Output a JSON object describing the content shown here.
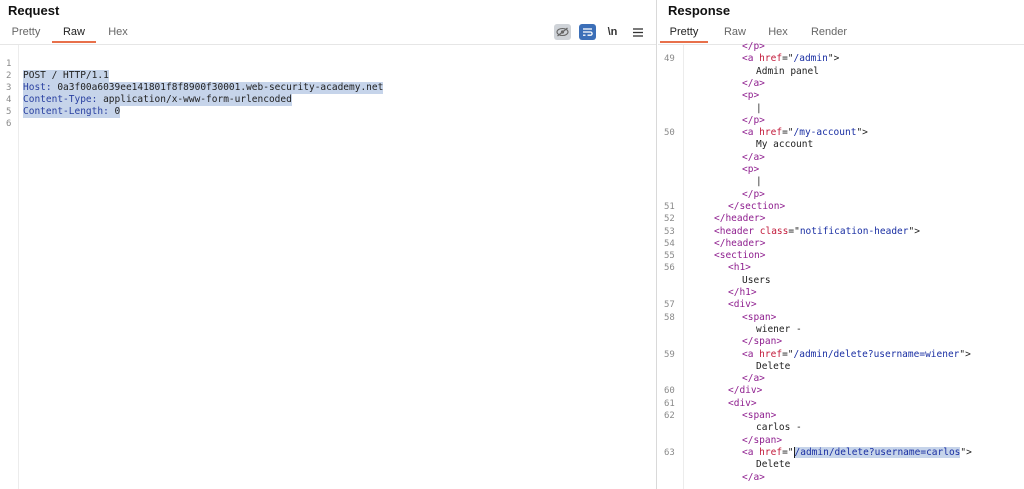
{
  "request": {
    "title": "Request",
    "tabs": [
      {
        "label": "Pretty",
        "active": false
      },
      {
        "label": "Raw",
        "active": true
      },
      {
        "label": "Hex",
        "active": false
      }
    ],
    "tools": {
      "hide_icon": "eye-off-icon",
      "wrap_icon": "wrap-lines-icon",
      "newline_label": "\\n",
      "menu_icon": "hamburger-menu-icon"
    },
    "lines": [
      {
        "num": "1",
        "method": "POST / HTTP/1.1"
      },
      {
        "num": "2",
        "name": "Host:",
        "value": " 0a3f00a6039ee141801f8f8900f30001.web-security-academy.net"
      },
      {
        "num": "3",
        "name": "Content-Type:",
        "value": " application/x-www-form-urlencoded"
      },
      {
        "num": "4",
        "name": "Content-Length:",
        "value": " 0"
      },
      {
        "num": "5"
      },
      {
        "num": "6"
      }
    ]
  },
  "response": {
    "title": "Response",
    "tabs": [
      {
        "label": "Pretty",
        "active": true
      },
      {
        "label": "Raw",
        "active": false
      },
      {
        "label": "Hex",
        "active": false
      },
      {
        "label": "Render",
        "active": false
      }
    ],
    "lines": {
      "l0": {
        "num": "",
        "tag": "</p>"
      },
      "l1": {
        "num": "49",
        "open": "<a ",
        "attr": "href",
        "eq": "=\"",
        "val": "/admin",
        "close": "\">"
      },
      "l2": {
        "num": "",
        "text": "Admin panel"
      },
      "l3": {
        "num": "",
        "tag": "</a>"
      },
      "l4": {
        "num": "",
        "tag": "<p>"
      },
      "l5": {
        "num": "",
        "text": "|"
      },
      "l6": {
        "num": "",
        "tag": "</p>"
      },
      "l7": {
        "num": "50",
        "open": "<a ",
        "attr": "href",
        "eq": "=\"",
        "val": "/my-account",
        "close": "\">"
      },
      "l8": {
        "num": "",
        "text": "My account"
      },
      "l9": {
        "num": "",
        "tag": "</a>"
      },
      "l10": {
        "num": "",
        "tag": "<p>"
      },
      "l11": {
        "num": "",
        "text": "|"
      },
      "l12": {
        "num": "",
        "tag": "</p>"
      },
      "l13": {
        "num": "51",
        "tag": "</section>"
      },
      "l14": {
        "num": "52",
        "tag": "</header>"
      },
      "l15": {
        "num": "53",
        "open": "<header ",
        "attr": "class",
        "eq": "=\"",
        "val": "notification-header",
        "close": "\">"
      },
      "l16": {
        "num": "54",
        "tag": "</header>"
      },
      "l17": {
        "num": "55",
        "tag": "<section>"
      },
      "l18": {
        "num": "56",
        "tag": "<h1>"
      },
      "l19": {
        "num": "",
        "text": "Users"
      },
      "l20": {
        "num": "",
        "tag": "</h1>"
      },
      "l21": {
        "num": "57",
        "tag": "<div>"
      },
      "l22": {
        "num": "58",
        "tag": "<span>"
      },
      "l23": {
        "num": "",
        "text": "wiener -"
      },
      "l24": {
        "num": "",
        "tag": "</span>"
      },
      "l25": {
        "num": "59",
        "open": "<a ",
        "attr": "href",
        "eq": "=\"",
        "val": "/admin/delete?username=wiener",
        "close": "\">"
      },
      "l26": {
        "num": "",
        "text": "Delete"
      },
      "l27": {
        "num": "",
        "tag": "</a>"
      },
      "l28": {
        "num": "60",
        "tag": "</div>"
      },
      "l29": {
        "num": "61",
        "tag": "<div>"
      },
      "l30": {
        "num": "62",
        "tag": "<span>"
      },
      "l31": {
        "num": "",
        "text": "carlos -"
      },
      "l32": {
        "num": "",
        "tag": "</span>"
      },
      "l33": {
        "num": "63",
        "open": "<a ",
        "attr": "href",
        "eq": "=\"",
        "val": "/admin/delete?username=carlos",
        "close": "\">"
      },
      "l34": {
        "num": "",
        "text": "Delete"
      },
      "l35": {
        "num": "",
        "tag": "</a>"
      }
    }
  },
  "colors": {
    "accent": "#e8704a",
    "selection": "#c6d4ea",
    "tool_active": "#3b6fb8",
    "tag": "#8f1f8f",
    "attr": "#c21a3a",
    "value": "#1a2fa3",
    "header_name": "#2a41a1"
  }
}
